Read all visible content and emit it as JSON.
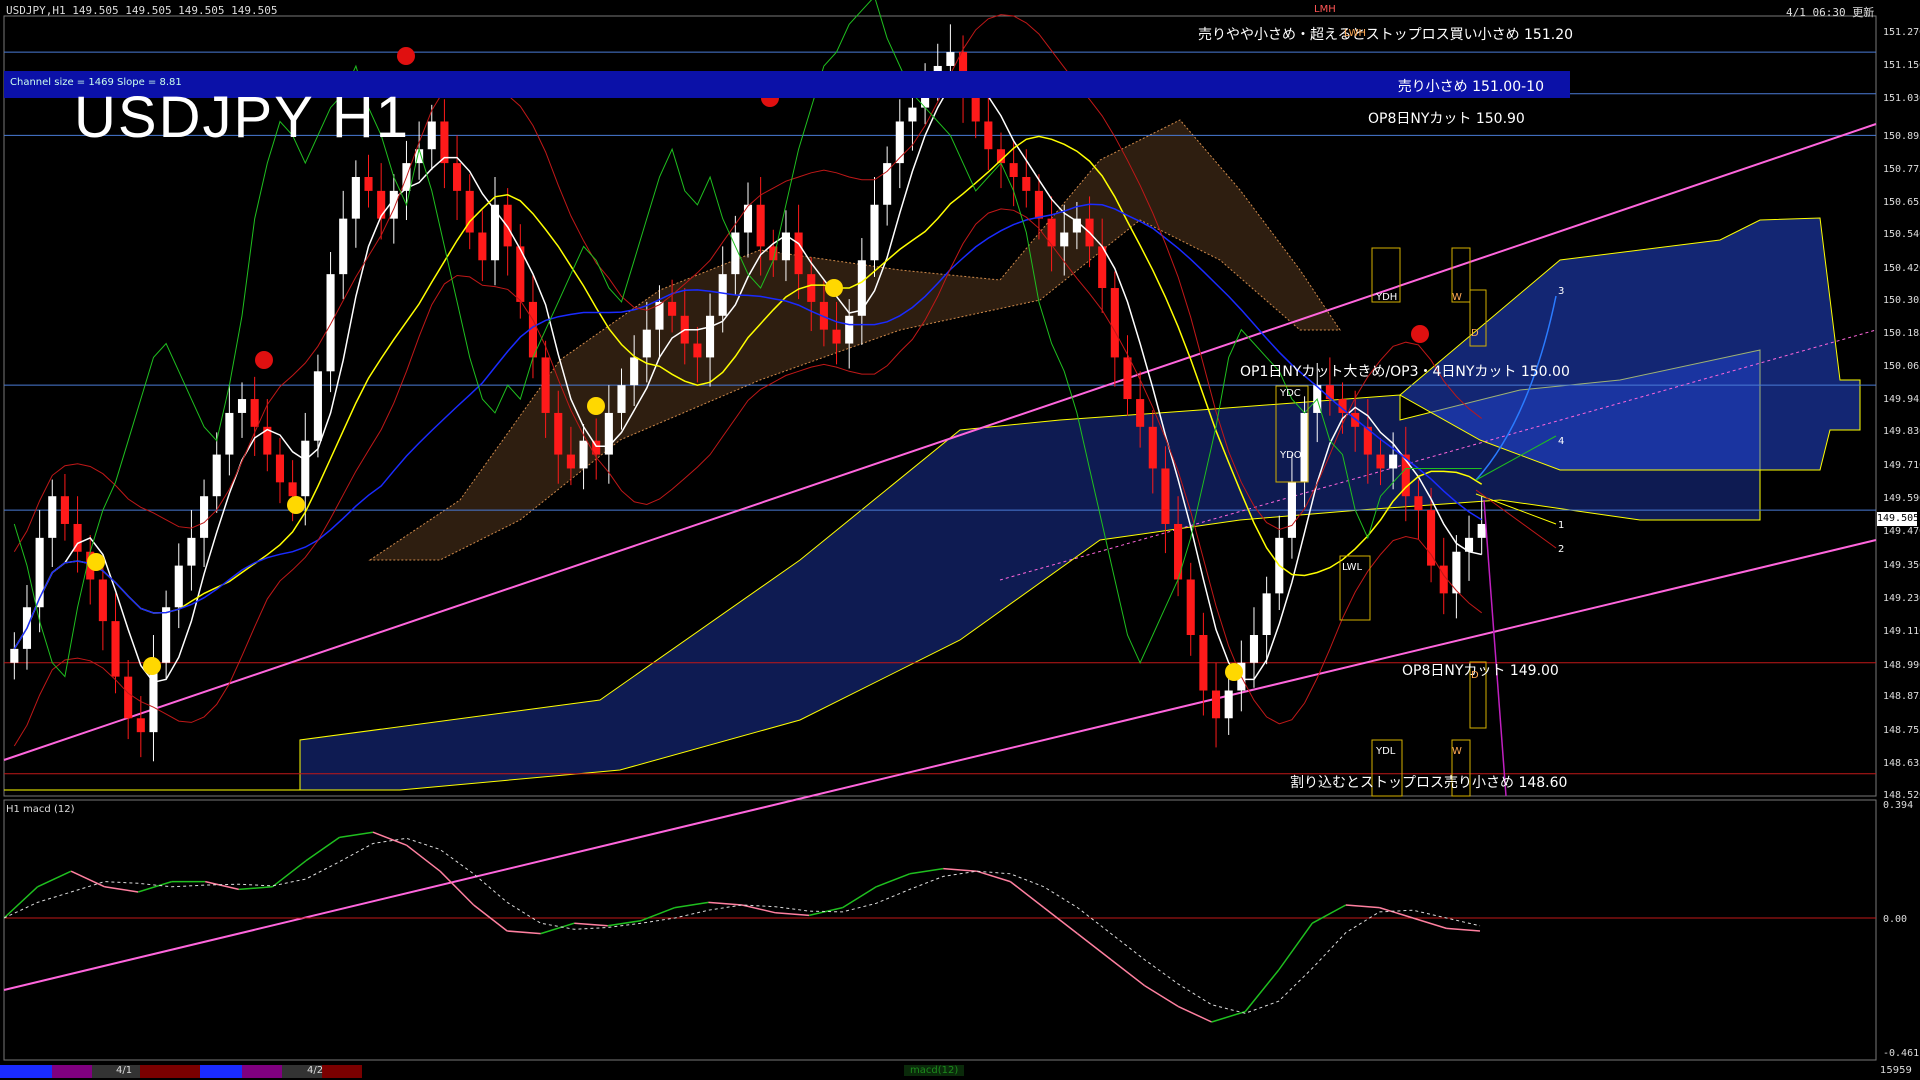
{
  "header": {
    "symbol_info": "USDJPY,H1  149.505 149.505 149.505 149.505",
    "update_time": "4/1 06:30 更新",
    "subwindow_label": "H1 macd (12)"
  },
  "overlay": {
    "big_title": "USDJPY H1",
    "channel_info": "Channel size = 1469 Slope = 8.81"
  },
  "annotations": {
    "line_151_20": "売りやや小さめ・超えるとストップロス買い小さめ 151.20",
    "line_151_00": "売り小さめ 151.00-10",
    "line_150_90": "OP8日NYカット 150.90",
    "line_150_00": "OP1日NYカット大きめ/OP3・4日NYカット 150.00",
    "line_149_00": "OP8日NYカット 149.00",
    "line_148_60": "割り込むとストップロス売り小さめ 148.60"
  },
  "level_boxes": {
    "ydh": "YDH",
    "ydc": "YDC",
    "ydo": "YDO",
    "lwl": "LWL",
    "ydl": "YDL",
    "w1": "W",
    "w2": "W",
    "d1": "D",
    "d2": "D",
    "lmh": "LMH",
    "lwh": "LWH",
    "n1": "1",
    "n2": "2",
    "n3": "3",
    "n4": "4"
  },
  "price_axis": [
    "151.270",
    "151.150",
    "151.030",
    "150.895",
    "150.775",
    "150.655",
    "150.540",
    "150.420",
    "150.305",
    "150.185",
    "150.065",
    "149.945",
    "149.830",
    "149.710",
    "149.590",
    "149.470",
    "149.350",
    "149.230",
    "149.110",
    "148.990",
    "148.875",
    "148.755",
    "148.635",
    "148.520"
  ],
  "current_price": "149.505",
  "macd_axis": {
    "top": "0.394",
    "zero": "0.00",
    "bottom": "-0.461"
  },
  "bottom_bar": {
    "date1": "4/1",
    "date2": "4/2",
    "tab": "macd(12)",
    "right_num": "15959"
  },
  "colors": {
    "bull": "#ffffff",
    "bear": "#ff1a1a",
    "ma_white": "#ffffff",
    "ma_yellow": "#ffff00",
    "ma_blue": "#1a2bff",
    "channel": "#ff66dd",
    "hline_blue": "#4a7bd6",
    "hline_red": "#c01818",
    "ichimoku_blue": "#2a55ff",
    "ichimoku_orange": "#d08a4a"
  },
  "chart_data": {
    "type": "candlestick",
    "symbol": "USDJPY",
    "timeframe": "H1",
    "ylim": [
      148.52,
      151.33
    ],
    "horizontal_levels": [
      151.2,
      151.05,
      150.9,
      150.0,
      149.55,
      149.0,
      148.6
    ],
    "close": [
      149.05,
      149.2,
      149.45,
      149.6,
      149.5,
      149.4,
      149.3,
      149.15,
      148.95,
      148.8,
      148.75,
      149.0,
      149.2,
      149.35,
      149.45,
      149.6,
      149.75,
      149.9,
      149.95,
      149.85,
      149.75,
      149.65,
      149.6,
      149.8,
      150.05,
      150.4,
      150.6,
      150.75,
      150.7,
      150.6,
      150.7,
      150.8,
      150.85,
      150.95,
      150.8,
      150.7,
      150.55,
      150.45,
      150.65,
      150.5,
      150.3,
      150.1,
      149.9,
      149.75,
      149.7,
      149.8,
      149.75,
      149.9,
      150.0,
      150.1,
      150.2,
      150.3,
      150.25,
      150.15,
      150.1,
      150.25,
      150.4,
      150.55,
      150.65,
      150.5,
      150.45,
      150.55,
      150.4,
      150.3,
      150.2,
      150.15,
      150.25,
      150.45,
      150.65,
      150.8,
      150.95,
      151.0,
      151.1,
      151.15,
      151.2,
      151.05,
      150.95,
      150.85,
      150.8,
      150.75,
      150.7,
      150.6,
      150.5,
      150.55,
      150.6,
      150.5,
      150.35,
      150.1,
      149.95,
      149.85,
      149.7,
      149.5,
      149.3,
      149.1,
      148.9,
      148.8,
      148.9,
      149.0,
      149.1,
      149.25,
      149.45,
      149.65,
      149.9,
      150.0,
      149.95,
      149.9,
      149.85,
      149.75,
      149.7,
      149.75,
      149.6,
      149.55,
      149.35,
      149.25,
      149.4,
      149.45,
      149.5
    ]
  }
}
